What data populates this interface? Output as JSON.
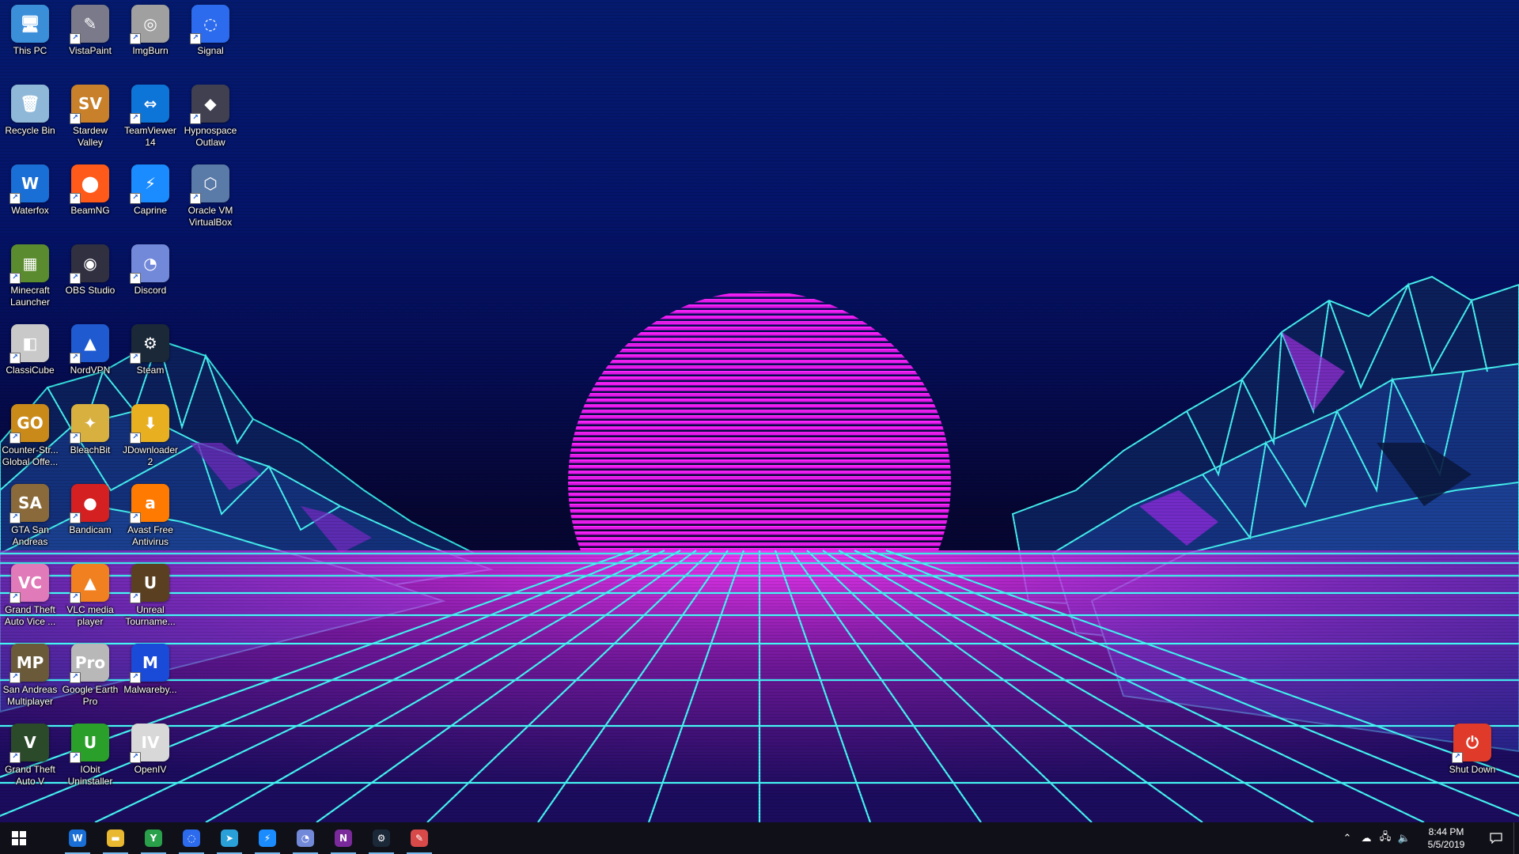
{
  "desktop": {
    "icons": [
      {
        "label": "This PC",
        "glyph": "🖥",
        "color": "#3b8fd9"
      },
      {
        "label": "Recycle Bin",
        "glyph": "🗑",
        "color": "#8fb8d8"
      },
      {
        "label": "Waterfox",
        "glyph": "W",
        "color": "#1a6fd6"
      },
      {
        "label": "Minecraft Launcher",
        "glyph": "▦",
        "color": "#5b8b2f"
      },
      {
        "label": "ClassiCube",
        "glyph": "◧",
        "color": "#c9c9c9"
      },
      {
        "label": "Counter-Str... Global Offe...",
        "glyph": "GO",
        "color": "#c98a1a"
      },
      {
        "label": "GTA San Andreas",
        "glyph": "SA",
        "color": "#8a6a3a"
      },
      {
        "label": "Grand Theft Auto Vice ...",
        "glyph": "VC",
        "color": "#e07ab8"
      },
      {
        "label": "San Andreas Multiplayer",
        "glyph": "MP",
        "color": "#6a5a3a"
      },
      {
        "label": "Grand Theft Auto V",
        "glyph": "V",
        "color": "#2a4a2a"
      },
      {
        "label": "VistaPaint",
        "glyph": "✎",
        "color": "#7a7a8a"
      },
      {
        "label": "Stardew Valley",
        "glyph": "SV",
        "color": "#c8802a"
      },
      {
        "label": "BeamNG",
        "glyph": "⬤",
        "color": "#ff5a1a"
      },
      {
        "label": "OBS Studio",
        "glyph": "◉",
        "color": "#303040"
      },
      {
        "label": "NordVPN",
        "glyph": "▲",
        "color": "#1f5ad1"
      },
      {
        "label": "BleachBit",
        "glyph": "✦",
        "color": "#d8b040"
      },
      {
        "label": "Bandicam",
        "glyph": "●",
        "color": "#d42020"
      },
      {
        "label": "VLC media player",
        "glyph": "▲",
        "color": "#f08020"
      },
      {
        "label": "Google Earth Pro",
        "glyph": "Pro",
        "color": "#b8b8b8"
      },
      {
        "label": "IObit Uninstaller",
        "glyph": "U",
        "color": "#2aa02a"
      },
      {
        "label": "ImgBurn",
        "glyph": "◎",
        "color": "#a0a0a0"
      },
      {
        "label": "TeamViewer 14",
        "glyph": "⇔",
        "color": "#0e75d8"
      },
      {
        "label": "Caprine",
        "glyph": "⚡",
        "color": "#1a8cff"
      },
      {
        "label": "Discord",
        "glyph": "◔",
        "color": "#7289da"
      },
      {
        "label": "Steam",
        "glyph": "⚙",
        "color": "#1b2838"
      },
      {
        "label": "JDownloader 2",
        "glyph": "⬇",
        "color": "#e8b020"
      },
      {
        "label": "Avast Free Antivirus",
        "glyph": "a",
        "color": "#ff7a00"
      },
      {
        "label": "Unreal Tourname...",
        "glyph": "U",
        "color": "#5a4020"
      },
      {
        "label": "Malwareby...",
        "glyph": "M",
        "color": "#1a4ad8"
      },
      {
        "label": "OpenIV",
        "glyph": "IV",
        "color": "#d8d8d8"
      },
      {
        "label": "Signal",
        "glyph": "◌",
        "color": "#2c6bed"
      },
      {
        "label": "Hypnospace Outlaw",
        "glyph": "◆",
        "color": "#404050"
      },
      {
        "label": "Oracle VM VirtualBox",
        "glyph": "⬡",
        "color": "#5a7aa8"
      },
      {
        "label": "Shut Down",
        "glyph": "⏻",
        "color": "#e03a2a"
      }
    ]
  },
  "taskbar": {
    "buttons": [
      {
        "name": "waterfox",
        "glyph": "W",
        "color": "#1a6fd6"
      },
      {
        "name": "file-explorer",
        "glyph": "▬",
        "color": "#e8b830"
      },
      {
        "name": "yandex",
        "glyph": "Y",
        "color": "#2aa04a"
      },
      {
        "name": "signal",
        "glyph": "◌",
        "color": "#2c6bed"
      },
      {
        "name": "telegram",
        "glyph": "➤",
        "color": "#2aa0d8"
      },
      {
        "name": "caprine",
        "glyph": "⚡",
        "color": "#1a8cff"
      },
      {
        "name": "discord",
        "glyph": "◔",
        "color": "#7289da"
      },
      {
        "name": "onenote",
        "glyph": "N",
        "color": "#7a2a9a"
      },
      {
        "name": "steam",
        "glyph": "⚙",
        "color": "#1b2838"
      },
      {
        "name": "paint",
        "glyph": "✎",
        "color": "#d84a4a"
      }
    ],
    "clock": {
      "time": "8:44 PM",
      "date": "5/5/2019"
    }
  }
}
